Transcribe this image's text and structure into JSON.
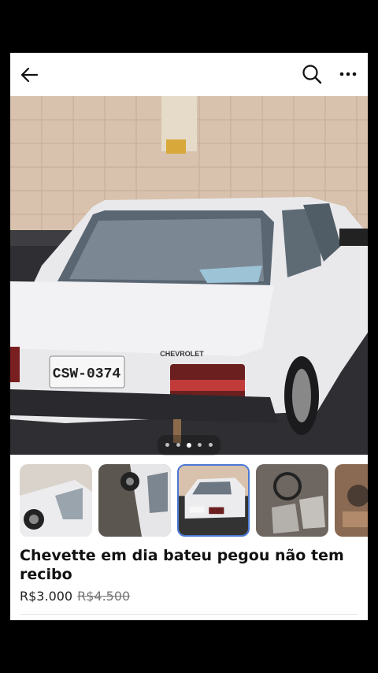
{
  "listing": {
    "title": "Chevette em dia bateu pegou não tem recibo",
    "price": "R$3.000",
    "old_price": "R$4.500",
    "plate_text": "CSW-0374",
    "brand_badge": "CHEVROLET",
    "image_count": 5,
    "active_image_index": 3
  },
  "toolbar": {
    "back_icon": "arrow-left-icon",
    "search_icon": "search-icon",
    "more_icon": "more-horizontal-icon"
  },
  "colors": {
    "accent": "#4a78d6",
    "background": "#000000",
    "card": "#ffffff"
  }
}
